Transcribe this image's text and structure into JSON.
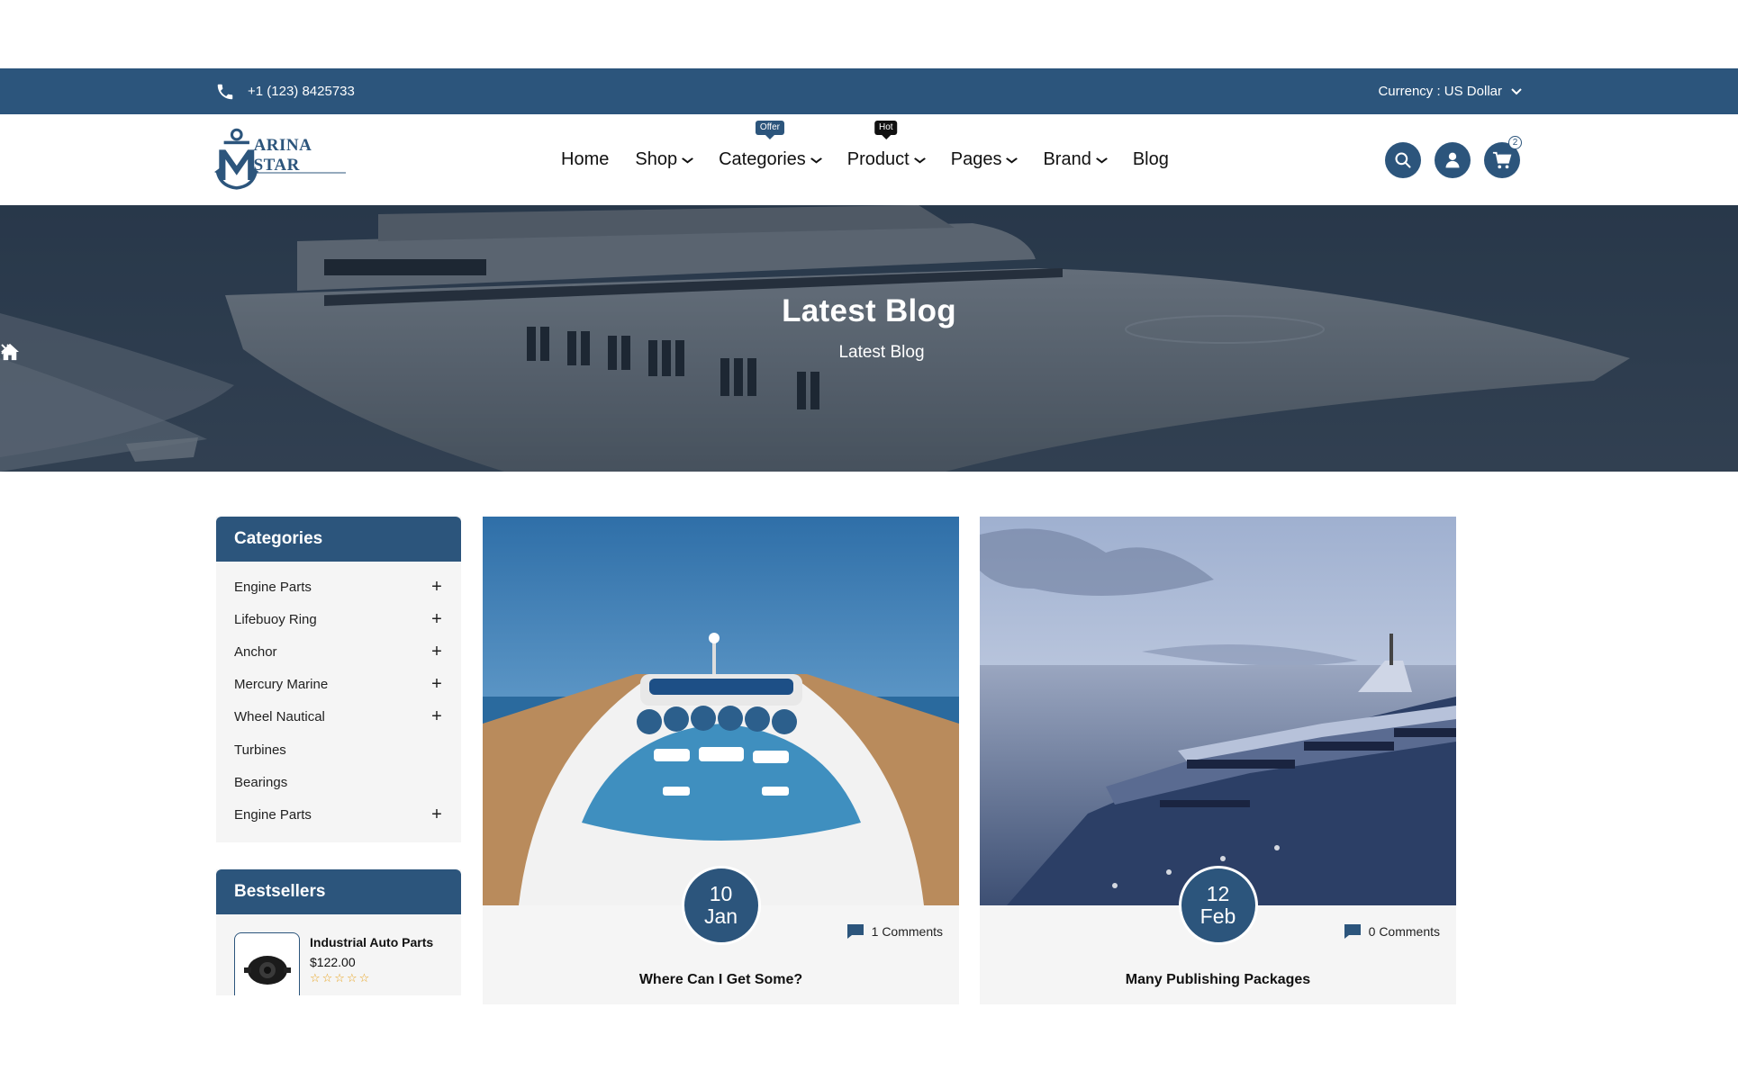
{
  "topbar": {
    "phone": "+1 (123) 8425733",
    "currency_label": "Currency : US Dollar",
    "bg_color": "#2c557c"
  },
  "header": {
    "logo_text": "ARINA STAR",
    "nav": [
      {
        "label": "Home",
        "dropdown": false,
        "badge": ""
      },
      {
        "label": "Shop",
        "dropdown": true,
        "badge": ""
      },
      {
        "label": "Categories",
        "dropdown": true,
        "badge": "Offer"
      },
      {
        "label": "Product",
        "dropdown": true,
        "badge": "Hot"
      },
      {
        "label": "Pages",
        "dropdown": true,
        "badge": ""
      },
      {
        "label": "Brand",
        "dropdown": true,
        "badge": ""
      },
      {
        "label": "Blog",
        "dropdown": false,
        "badge": ""
      }
    ],
    "icons": [
      "search-icon",
      "user-icon",
      "cart-icon"
    ],
    "cart_count": "2"
  },
  "hero": {
    "title": "Latest Blog",
    "breadcrumb_current": "Latest Blog"
  },
  "sidebar": {
    "categories_title": "Categories",
    "categories": [
      {
        "label": "Engine Parts",
        "expandable": true
      },
      {
        "label": "Lifebuoy Ring",
        "expandable": true
      },
      {
        "label": "Anchor",
        "expandable": true
      },
      {
        "label": "Mercury Marine",
        "expandable": true
      },
      {
        "label": "Wheel Nautical",
        "expandable": true
      },
      {
        "label": "Turbines",
        "expandable": false
      },
      {
        "label": "Bearings",
        "expandable": false
      },
      {
        "label": "Engine Parts",
        "expandable": true
      }
    ],
    "bestsellers_title": "Bestsellers",
    "bestsellers": [
      {
        "name": "Industrial Auto Parts",
        "price": "$122.00",
        "rating": 0
      }
    ]
  },
  "posts": [
    {
      "day": "10",
      "month": "Jan",
      "comments": "1 Comments",
      "title": "Where Can I Get Some?"
    },
    {
      "day": "12",
      "month": "Feb",
      "comments": "0 Comments",
      "title": "Many Publishing Packages"
    }
  ]
}
